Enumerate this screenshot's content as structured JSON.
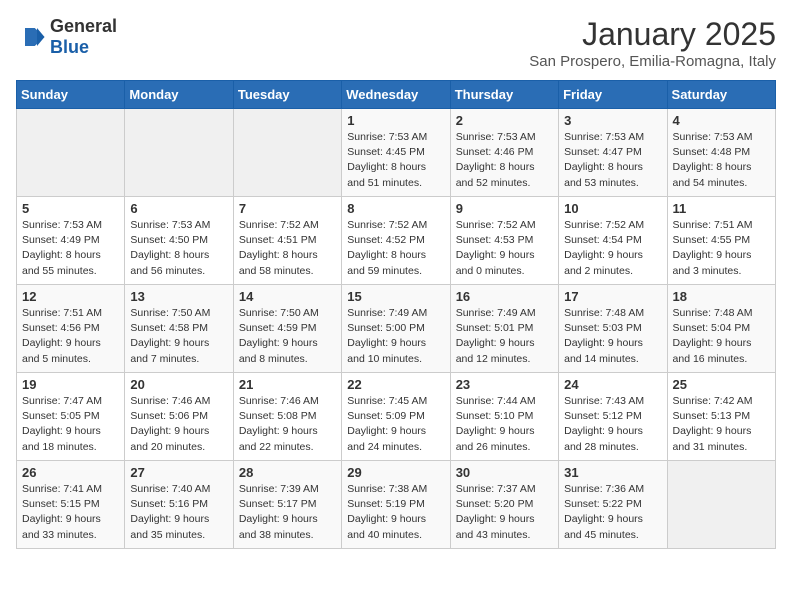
{
  "header": {
    "logo_general": "General",
    "logo_blue": "Blue",
    "month_title": "January 2025",
    "location": "San Prospero, Emilia-Romagna, Italy"
  },
  "days_of_week": [
    "Sunday",
    "Monday",
    "Tuesday",
    "Wednesday",
    "Thursday",
    "Friday",
    "Saturday"
  ],
  "weeks": [
    [
      {
        "day": "",
        "sunrise": "",
        "sunset": "",
        "daylight": "",
        "empty": true
      },
      {
        "day": "",
        "sunrise": "",
        "sunset": "",
        "daylight": "",
        "empty": true
      },
      {
        "day": "",
        "sunrise": "",
        "sunset": "",
        "daylight": "",
        "empty": true
      },
      {
        "day": "1",
        "sunrise": "7:53 AM",
        "sunset": "4:45 PM",
        "daylight": "8 hours and 51 minutes."
      },
      {
        "day": "2",
        "sunrise": "7:53 AM",
        "sunset": "4:46 PM",
        "daylight": "8 hours and 52 minutes."
      },
      {
        "day": "3",
        "sunrise": "7:53 AM",
        "sunset": "4:47 PM",
        "daylight": "8 hours and 53 minutes."
      },
      {
        "day": "4",
        "sunrise": "7:53 AM",
        "sunset": "4:48 PM",
        "daylight": "8 hours and 54 minutes."
      }
    ],
    [
      {
        "day": "5",
        "sunrise": "7:53 AM",
        "sunset": "4:49 PM",
        "daylight": "8 hours and 55 minutes."
      },
      {
        "day": "6",
        "sunrise": "7:53 AM",
        "sunset": "4:50 PM",
        "daylight": "8 hours and 56 minutes."
      },
      {
        "day": "7",
        "sunrise": "7:52 AM",
        "sunset": "4:51 PM",
        "daylight": "8 hours and 58 minutes."
      },
      {
        "day": "8",
        "sunrise": "7:52 AM",
        "sunset": "4:52 PM",
        "daylight": "8 hours and 59 minutes."
      },
      {
        "day": "9",
        "sunrise": "7:52 AM",
        "sunset": "4:53 PM",
        "daylight": "9 hours and 0 minutes."
      },
      {
        "day": "10",
        "sunrise": "7:52 AM",
        "sunset": "4:54 PM",
        "daylight": "9 hours and 2 minutes."
      },
      {
        "day": "11",
        "sunrise": "7:51 AM",
        "sunset": "4:55 PM",
        "daylight": "9 hours and 3 minutes."
      }
    ],
    [
      {
        "day": "12",
        "sunrise": "7:51 AM",
        "sunset": "4:56 PM",
        "daylight": "9 hours and 5 minutes."
      },
      {
        "day": "13",
        "sunrise": "7:50 AM",
        "sunset": "4:58 PM",
        "daylight": "9 hours and 7 minutes."
      },
      {
        "day": "14",
        "sunrise": "7:50 AM",
        "sunset": "4:59 PM",
        "daylight": "9 hours and 8 minutes."
      },
      {
        "day": "15",
        "sunrise": "7:49 AM",
        "sunset": "5:00 PM",
        "daylight": "9 hours and 10 minutes."
      },
      {
        "day": "16",
        "sunrise": "7:49 AM",
        "sunset": "5:01 PM",
        "daylight": "9 hours and 12 minutes."
      },
      {
        "day": "17",
        "sunrise": "7:48 AM",
        "sunset": "5:03 PM",
        "daylight": "9 hours and 14 minutes."
      },
      {
        "day": "18",
        "sunrise": "7:48 AM",
        "sunset": "5:04 PM",
        "daylight": "9 hours and 16 minutes."
      }
    ],
    [
      {
        "day": "19",
        "sunrise": "7:47 AM",
        "sunset": "5:05 PM",
        "daylight": "9 hours and 18 minutes."
      },
      {
        "day": "20",
        "sunrise": "7:46 AM",
        "sunset": "5:06 PM",
        "daylight": "9 hours and 20 minutes."
      },
      {
        "day": "21",
        "sunrise": "7:46 AM",
        "sunset": "5:08 PM",
        "daylight": "9 hours and 22 minutes."
      },
      {
        "day": "22",
        "sunrise": "7:45 AM",
        "sunset": "5:09 PM",
        "daylight": "9 hours and 24 minutes."
      },
      {
        "day": "23",
        "sunrise": "7:44 AM",
        "sunset": "5:10 PM",
        "daylight": "9 hours and 26 minutes."
      },
      {
        "day": "24",
        "sunrise": "7:43 AM",
        "sunset": "5:12 PM",
        "daylight": "9 hours and 28 minutes."
      },
      {
        "day": "25",
        "sunrise": "7:42 AM",
        "sunset": "5:13 PM",
        "daylight": "9 hours and 31 minutes."
      }
    ],
    [
      {
        "day": "26",
        "sunrise": "7:41 AM",
        "sunset": "5:15 PM",
        "daylight": "9 hours and 33 minutes."
      },
      {
        "day": "27",
        "sunrise": "7:40 AM",
        "sunset": "5:16 PM",
        "daylight": "9 hours and 35 minutes."
      },
      {
        "day": "28",
        "sunrise": "7:39 AM",
        "sunset": "5:17 PM",
        "daylight": "9 hours and 38 minutes."
      },
      {
        "day": "29",
        "sunrise": "7:38 AM",
        "sunset": "5:19 PM",
        "daylight": "9 hours and 40 minutes."
      },
      {
        "day": "30",
        "sunrise": "7:37 AM",
        "sunset": "5:20 PM",
        "daylight": "9 hours and 43 minutes."
      },
      {
        "day": "31",
        "sunrise": "7:36 AM",
        "sunset": "5:22 PM",
        "daylight": "9 hours and 45 minutes."
      },
      {
        "day": "",
        "sunrise": "",
        "sunset": "",
        "daylight": "",
        "empty": true
      }
    ]
  ]
}
